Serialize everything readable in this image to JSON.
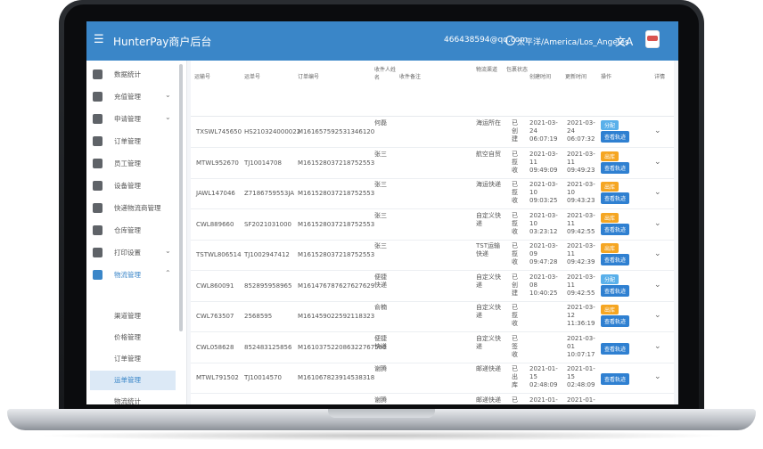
{
  "header": {
    "title": "HunterPay商户后台",
    "email": "466438594@qq.com",
    "timezone": "太平洋/America/Los_Angeles",
    "lang_icon": "translate-icon"
  },
  "sidebar": {
    "items": [
      {
        "label": "数据统计",
        "icon": "chart-icon",
        "arrow": ""
      },
      {
        "label": "充值管理",
        "icon": "wallet-icon",
        "arrow": "⌄"
      },
      {
        "label": "申请管理",
        "icon": "gavel-icon",
        "arrow": "⌄"
      },
      {
        "label": "订单管理",
        "icon": "store-icon",
        "arrow": ""
      },
      {
        "label": "员工管理",
        "icon": "people-icon",
        "arrow": ""
      },
      {
        "label": "设备管理",
        "icon": "device-icon",
        "arrow": ""
      },
      {
        "label": "快递物流商管理",
        "icon": "list-icon",
        "arrow": ""
      },
      {
        "label": "仓库管理",
        "icon": "warehouse-icon",
        "arrow": ""
      },
      {
        "label": "打印设置",
        "icon": "print-icon",
        "arrow": "⌄"
      },
      {
        "label": "物流管理",
        "icon": "box-icon",
        "arrow": "⌃"
      }
    ],
    "sub_items": [
      {
        "label": "渠道管理"
      },
      {
        "label": "价格管理"
      },
      {
        "label": "订单管理"
      },
      {
        "label": "运单管理"
      },
      {
        "label": "物流统计"
      },
      {
        "label": "价格统计"
      }
    ]
  },
  "table": {
    "headers": [
      "运输号",
      "运单号",
      "订单编号",
      "收件人姓名",
      "收件备注",
      "物流渠道",
      "包裹状态",
      "创建时间",
      "更新时间",
      "操作",
      "详情"
    ],
    "rows": [
      {
        "a": "TXSWL745650",
        "b": "HS210324000022",
        "c": "M161657592531346120",
        "d": "何磊",
        "e": "",
        "f": "海运所在",
        "g": "已创建",
        "h": "2021-03-24 06:07:19",
        "i": "2021-03-24 06:07:32",
        "tag": "分配",
        "tagc": "blue",
        "track": "查看轨迹"
      },
      {
        "a": "MTWL952670",
        "b": "TJ10014708",
        "c": "M161528037218752553",
        "d": "张三",
        "e": "",
        "f": "航空自贸",
        "g": "已揽收",
        "h": "2021-03-11 09:49:09",
        "i": "2021-03-11 09:49:23",
        "tag": "出库",
        "tagc": "orange",
        "track": "查看轨迹"
      },
      {
        "a": "JAWL147046",
        "b": "Z7186759553JA",
        "c": "M161528037218752553",
        "d": "张三",
        "e": "",
        "f": "海运快递",
        "g": "已揽收",
        "h": "2021-03-10 09:03:25",
        "i": "2021-03-10 09:43:23",
        "tag": "出库",
        "tagc": "orange",
        "track": "查看轨迹"
      },
      {
        "a": "CWL889660",
        "b": "SF2021031000",
        "c": "M161528037218752553",
        "d": "张三",
        "e": "",
        "f": "自定义快递",
        "g": "已揽收",
        "h": "2021-03-10 03:23:12",
        "i": "2021-03-11 09:42:55",
        "tag": "出库",
        "tagc": "orange",
        "track": "查看轨迹"
      },
      {
        "a": "TSTWL806514",
        "b": "TJ1002947412",
        "c": "M161528037218752553",
        "d": "张三",
        "e": "",
        "f": "TST运输快递",
        "g": "已揽收",
        "h": "2021-03-09 09:47:28",
        "i": "2021-03-11 09:42:39",
        "tag": "出库",
        "tagc": "orange",
        "track": "查看轨迹"
      },
      {
        "a": "CWL860091",
        "b": "852895958965",
        "c": "M161476787627627629",
        "d": "便捷快递",
        "e": "",
        "f": "自定义快递",
        "g": "已创建",
        "h": "2021-03-08 10:40:25",
        "i": "2021-03-11 09:42:55",
        "tag": "分配",
        "tagc": "blue",
        "track": "查看轨迹"
      },
      {
        "a": "CWL763507",
        "b": "2568595",
        "c": "M161459022592118323",
        "d": "俞楠",
        "e": "",
        "f": "自定义快递",
        "g": "已揽收",
        "h": "",
        "i": "2021-03-12 11:36:19",
        "tag": "出库",
        "tagc": "orange",
        "track": "查看轨迹"
      },
      {
        "a": "CWL058628",
        "b": "852483125856",
        "c": "M161037522086322767580",
        "d": "便捷快递",
        "e": "",
        "f": "自定义快递",
        "g": "已签收",
        "h": "",
        "i": "2021-03-01 10:07:17",
        "tag": "",
        "tagc": "",
        "track": "查看轨迹"
      },
      {
        "a": "MTWL791502",
        "b": "TJ10014570",
        "c": "M161067823914538318",
        "d": "谢腾",
        "e": "",
        "f": "邮递快递",
        "g": "已出库",
        "h": "2021-01-15 02:48:09",
        "i": "2021-01-15 02:48:09",
        "tag": "",
        "tagc": "",
        "track": "查看轨迹"
      },
      {
        "a": "MTWL415757",
        "b": "TJ10014566",
        "c": "M161067829184485319",
        "d": "谢腾",
        "e": "",
        "f": "邮递快递",
        "g": "已出库",
        "h": "2021-01-15 02:45:08",
        "i": "2021-01-15 02:45:08",
        "tag": "",
        "tagc": "",
        "track": "查看轨迹"
      }
    ]
  }
}
